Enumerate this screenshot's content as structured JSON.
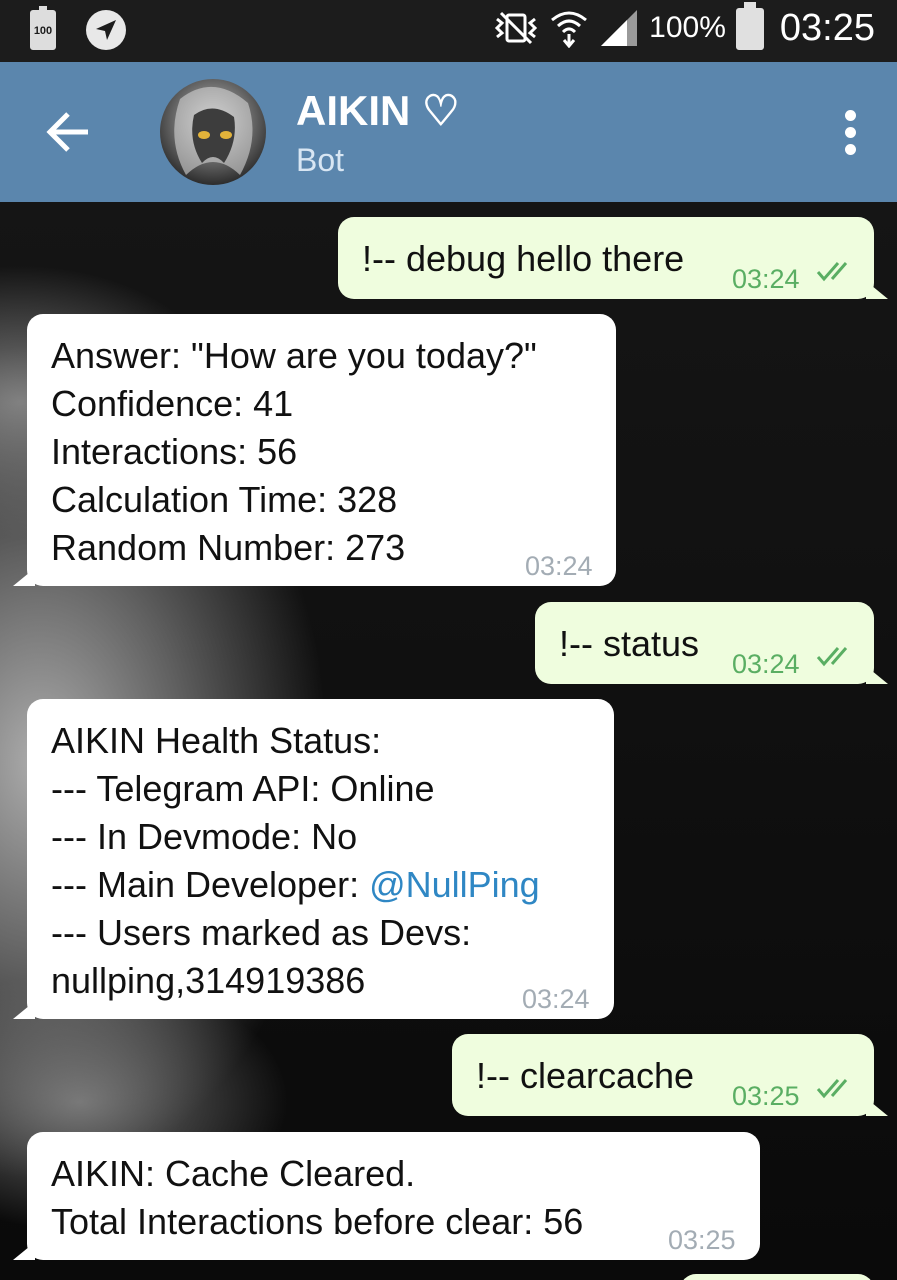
{
  "status_bar": {
    "battery_small_label": "100",
    "battery_percent": "100%",
    "clock": "03:25",
    "icons": [
      "battery-small-icon",
      "navigation-icon",
      "vibrate-icon",
      "wifi-icon",
      "signal-icon",
      "battery-icon"
    ]
  },
  "header": {
    "back_icon": "arrow-left-icon",
    "title": "AIKIN ♡",
    "subtitle": "Bot",
    "menu_icon": "more-vertical-icon"
  },
  "messages": [
    {
      "direction": "out",
      "text": "!-- debug hello there",
      "time": "03:24",
      "status": "read"
    },
    {
      "direction": "in",
      "lines": [
        "Answer: \"How are you today?\"",
        "Confidence: 41",
        "Interactions: 56",
        "Calculation Time: 328",
        "Random Number: 273"
      ],
      "time": "03:24"
    },
    {
      "direction": "out",
      "text": "!-- status",
      "time": "03:24",
      "status": "read"
    },
    {
      "direction": "in",
      "lines": [
        "AIKIN Health Status:",
        "--- Telegram API: Online",
        "--- In Devmode: No",
        "--- Main Developer: ",
        "--- Users marked as Devs:",
        "nullping,314919386"
      ],
      "mention": "@NullPing",
      "time": "03:24"
    },
    {
      "direction": "out",
      "text": "!-- clearcache",
      "time": "03:25",
      "status": "read"
    },
    {
      "direction": "in",
      "lines": [
        "AIKIN: Cache Cleared.",
        "Total Interactions before clear: 56"
      ],
      "time": "03:25"
    }
  ],
  "colors": {
    "header_bg": "#5b86ad",
    "outgoing_bubble": "#effdde",
    "incoming_bubble": "#ffffff",
    "outgoing_time": "#5aae63",
    "incoming_time": "#a3acb4",
    "link": "#2f87c4"
  }
}
